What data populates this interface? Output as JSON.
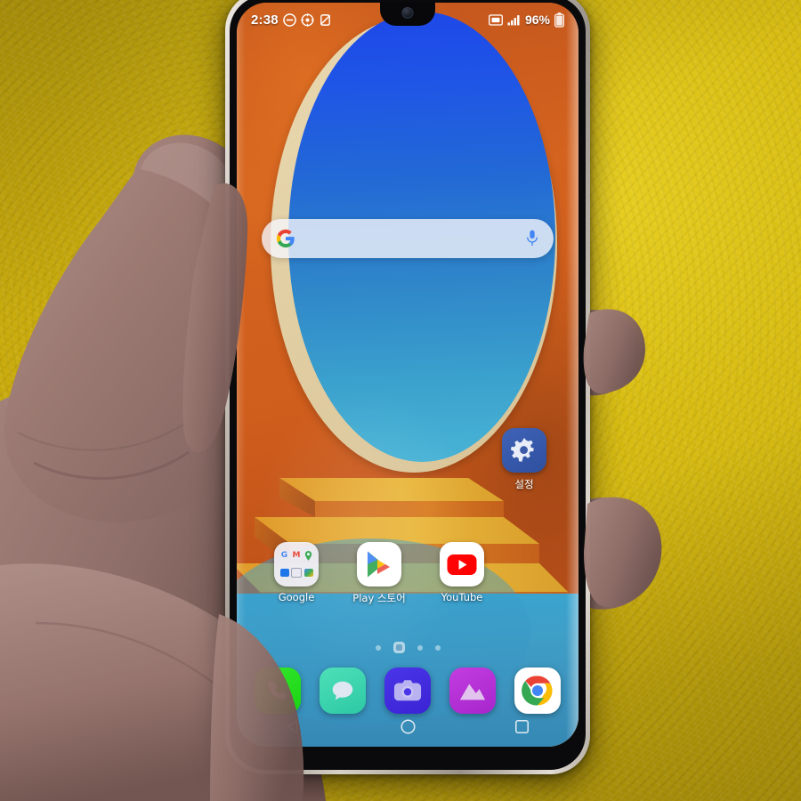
{
  "scene": {
    "description": "hand holding smartphone against yellow wall",
    "wall_color": "#d2b410",
    "skin_color": "#9d7b74"
  },
  "phone": {
    "bezel_color": "#cdc6bd",
    "screen_bg": "#c85a1e"
  },
  "statusbar": {
    "time": "2:38",
    "battery_percent": "96%",
    "left_icons": [
      "do-not-disturb-icon",
      "gear-icon",
      "mute-icon"
    ],
    "right_icons": [
      "sim-card-icon",
      "signal-bars-icon",
      "battery-icon"
    ]
  },
  "search": {
    "placeholder": "",
    "value": "",
    "logo": "google-g-logo",
    "mic": "microphone-icon"
  },
  "wallpaper": {
    "oval_color": "#2268d6",
    "ring_color": "#e2cfa4",
    "background_color": "#cf5d1c",
    "pool_color": "#3f9ec6"
  },
  "home": {
    "settings_app": {
      "label": "설정",
      "icon": "gear-icon",
      "bg": "#3f63b8"
    },
    "apps": [
      {
        "label": "Google",
        "icon": "google-folder-icon"
      },
      {
        "label": "Play 스토어",
        "icon": "play-store-icon"
      },
      {
        "label": "YouTube",
        "icon": "youtube-icon"
      }
    ],
    "folder_minis": [
      "G",
      "M",
      "Maps",
      "Meet",
      "Drive",
      "Photos"
    ]
  },
  "pagedots": {
    "count": 5,
    "active_index": 1
  },
  "dock": {
    "items": [
      {
        "label": "Phone",
        "icon": "phone-icon",
        "color": "#19d411"
      },
      {
        "label": "Messages",
        "icon": "message-bubble-icon",
        "color": "#2cc9a4"
      },
      {
        "label": "Camera",
        "icon": "camera-icon",
        "color": "#3a23d4"
      },
      {
        "label": "Gallery",
        "icon": "gallery-mountain-icon",
        "color": "#a626cc"
      },
      {
        "label": "Chrome",
        "icon": "chrome-icon",
        "color": "#ffffff"
      }
    ]
  },
  "navbar": {
    "items": [
      {
        "label": "Back",
        "icon": "back-triangle-icon"
      },
      {
        "label": "Home",
        "icon": "home-circle-icon"
      },
      {
        "label": "Recents",
        "icon": "recents-square-icon"
      }
    ]
  }
}
